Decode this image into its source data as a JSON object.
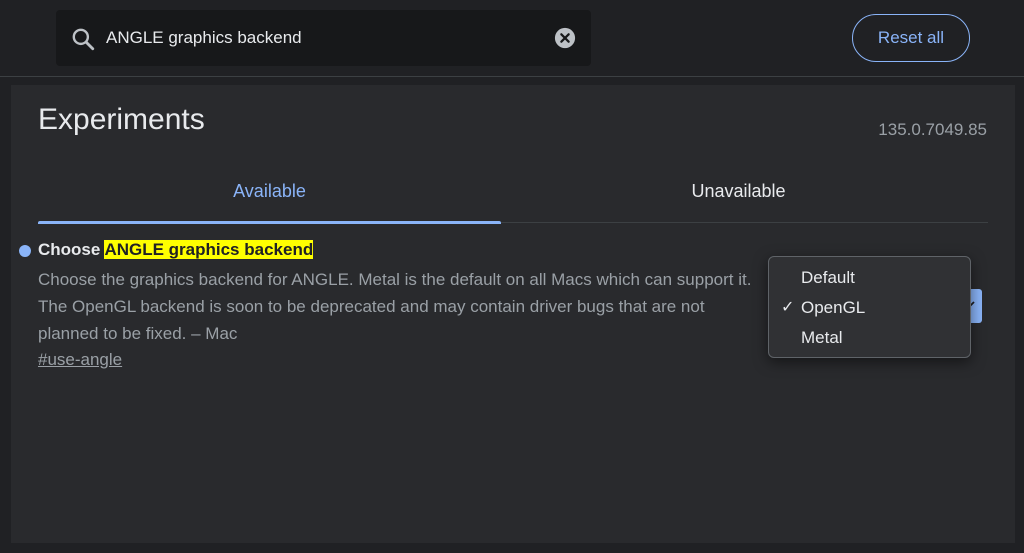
{
  "search": {
    "value": "ANGLE graphics backend",
    "icon": "search-icon",
    "clear_icon": "clear-icon"
  },
  "header": {
    "reset_label": "Reset all"
  },
  "page": {
    "title": "Experiments",
    "version": "135.0.7049.85"
  },
  "tabs": [
    {
      "label": "Available",
      "active": true
    },
    {
      "label": "Unavailable",
      "active": false
    }
  ],
  "experiment": {
    "title_prefix": "Choose ",
    "title_highlight": "ANGLE graphics backend",
    "description": "Choose the graphics backend for ANGLE. Metal is the default on all Macs which can support it. The OpenGL backend is soon to be deprecated and may contain driver bugs that are not planned to be fixed. – Mac",
    "link": "#use-angle"
  },
  "dropdown": {
    "options": [
      "Default",
      "OpenGL",
      "Metal"
    ],
    "selected": "OpenGL",
    "check_mark": "✓"
  },
  "colors": {
    "accent": "#8ab4f8",
    "highlight": "#ffff00",
    "background": "#202124",
    "panel": "#292a2d"
  }
}
